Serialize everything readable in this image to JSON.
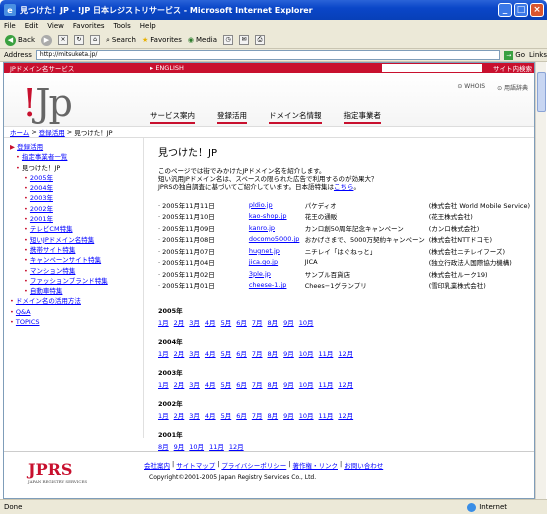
{
  "window": {
    "title": "見つけた！JP - !JP 日本レジストリサービス - Microsoft Internet Explorer"
  },
  "menu": [
    "File",
    "Edit",
    "View",
    "Favorites",
    "Tools",
    "Help"
  ],
  "toolbar": {
    "back": "Back",
    "search": "Search",
    "favorites": "Favorites",
    "media": "Media"
  },
  "address": {
    "label": "Address",
    "url": "http://mitsuketa.jp/",
    "go": "Go",
    "links": "Links"
  },
  "topbar": {
    "left": "JPドメイン名サービス",
    "english": "▸ ENGLISH",
    "search_button": "サイト内検索"
  },
  "header": {
    "logo_bang": "!",
    "logo_text": "Jp",
    "links": [
      "⊙ WHOIS",
      "⊙ 用語辞典"
    ],
    "tabs": [
      "サービス案内",
      "登録活用",
      "ドメイン名情報",
      "指定事業者"
    ]
  },
  "breadcrumb": {
    "home": "ホーム",
    "sep1": ">",
    "reg": "登録活用",
    "sep2": ">",
    "current": "見つけた！JP"
  },
  "sidebar": [
    {
      "label": "登録活用",
      "level": 1,
      "link": true,
      "bullet": "▶"
    },
    {
      "label": "指定事業者一覧",
      "level": 2,
      "link": true,
      "bullet": "•"
    },
    {
      "label": "見つけた！JP",
      "level": 2,
      "link": false,
      "bullet": "•"
    },
    {
      "label": "2005年",
      "level": 3,
      "link": true,
      "bullet": "•"
    },
    {
      "label": "2004年",
      "level": 3,
      "link": true,
      "bullet": "•"
    },
    {
      "label": "2003年",
      "level": 3,
      "link": true,
      "bullet": "•"
    },
    {
      "label": "2002年",
      "level": 3,
      "link": true,
      "bullet": "•"
    },
    {
      "label": "2001年",
      "level": 3,
      "link": true,
      "bullet": "•"
    },
    {
      "label": "テレビCM特集",
      "level": 3,
      "link": true,
      "bullet": "•"
    },
    {
      "label": "短いJPドメイン名特集",
      "level": 3,
      "link": true,
      "bullet": "•"
    },
    {
      "label": "携帯サイト特集",
      "level": 3,
      "link": true,
      "bullet": "•"
    },
    {
      "label": "キャンペーンサイト特集",
      "level": 3,
      "link": true,
      "bullet": "•"
    },
    {
      "label": "マンション特集",
      "level": 3,
      "link": true,
      "bullet": "•"
    },
    {
      "label": "ファッションブランド特集",
      "level": 3,
      "link": true,
      "bullet": "•"
    },
    {
      "label": "自動車特集",
      "level": 3,
      "link": true,
      "bullet": "•"
    },
    {
      "label": "ドメイン名の活用方法",
      "level": 1,
      "link": true,
      "bullet": "•"
    },
    {
      "label": "Q&A",
      "level": 1,
      "link": true,
      "bullet": "•"
    },
    {
      "label": "TOPICS",
      "level": 1,
      "link": true,
      "bullet": "•"
    }
  ],
  "main": {
    "title": "見つけた！JP",
    "intro": [
      "このページでは街でみかけたJPドメイン名を紹介します。",
      "短い汎用JPドメイン名は、スペースの限られた広告で利用するのが効果大？",
      "JPRSの独自調査に基づいてご紹介しています。日本語特集は"
    ],
    "intro_link": "こちら",
    "intro_end": "。",
    "rows": [
      {
        "date": "· 2005年11月11日",
        "domain": "pldio.jp",
        "name": "パケディオ",
        "company": "(株式会社 World Mobile Service)"
      },
      {
        "date": "· 2005年11月10日",
        "domain": "kao-shop.jp",
        "name": "花王の通販",
        "company": "(花王株式会社)"
      },
      {
        "date": "· 2005年11月09日",
        "domain": "kanro.jp",
        "name": "カンロ創50周年記念キャンペーン",
        "company": "(カンロ株式会社)"
      },
      {
        "date": "· 2005年11月08日",
        "domain": "docomo5000.jp",
        "name": "おかげさまで、5000万契約キャンペーン",
        "company": "(株式会社NTTドコモ)"
      },
      {
        "date": "· 2005年11月07日",
        "domain": "hugnet.jp",
        "name": "ニチレイ「はぐねっと」",
        "company": "(株式会社ニチレイフーズ)"
      },
      {
        "date": "· 2005年11月04日",
        "domain": "jica.go.jp",
        "name": "JICA",
        "company": "(独立行政法人国際協力機構)"
      },
      {
        "date": "· 2005年11月02日",
        "domain": "3ple.jp",
        "name": "サンプル百貨店",
        "company": "(株式会社ルーク19)"
      },
      {
        "date": "· 2005年11月01日",
        "domain": "cheese-1.jp",
        "name": "Chees−1グランプリ",
        "company": "(雪印乳業株式会社)"
      }
    ],
    "years": [
      {
        "year": "2005年",
        "months": [
          "1月",
          "2月",
          "3月",
          "4月",
          "5月",
          "6月",
          "7月",
          "8月",
          "9月",
          "10月"
        ]
      },
      {
        "year": "2004年",
        "months": [
          "1月",
          "2月",
          "3月",
          "4月",
          "5月",
          "6月",
          "7月",
          "8月",
          "9月",
          "10月",
          "11月",
          "12月"
        ]
      },
      {
        "year": "2003年",
        "months": [
          "1月",
          "2月",
          "3月",
          "4月",
          "5月",
          "6月",
          "7月",
          "8月",
          "9月",
          "10月",
          "11月",
          "12月"
        ]
      },
      {
        "year": "2002年",
        "months": [
          "1月",
          "2月",
          "3月",
          "4月",
          "5月",
          "6月",
          "7月",
          "8月",
          "9月",
          "10月",
          "11月",
          "12月"
        ]
      },
      {
        "year": "2001年",
        "months": [
          "8月",
          "9月",
          "10月",
          "11月",
          "12月"
        ]
      }
    ]
  },
  "footer": {
    "logo": "JPRS",
    "logo_sub": "JAPAN REGISTRY SERVICES",
    "links": [
      "会社案内",
      "サイトマップ",
      "プライバシーポリシー",
      "著作権・リンク",
      "お問い合わせ"
    ],
    "copyright": "Copyright©2001-2005 Japan Registry Services Co., Ltd."
  },
  "status": {
    "left": "Done",
    "zone": "Internet"
  }
}
